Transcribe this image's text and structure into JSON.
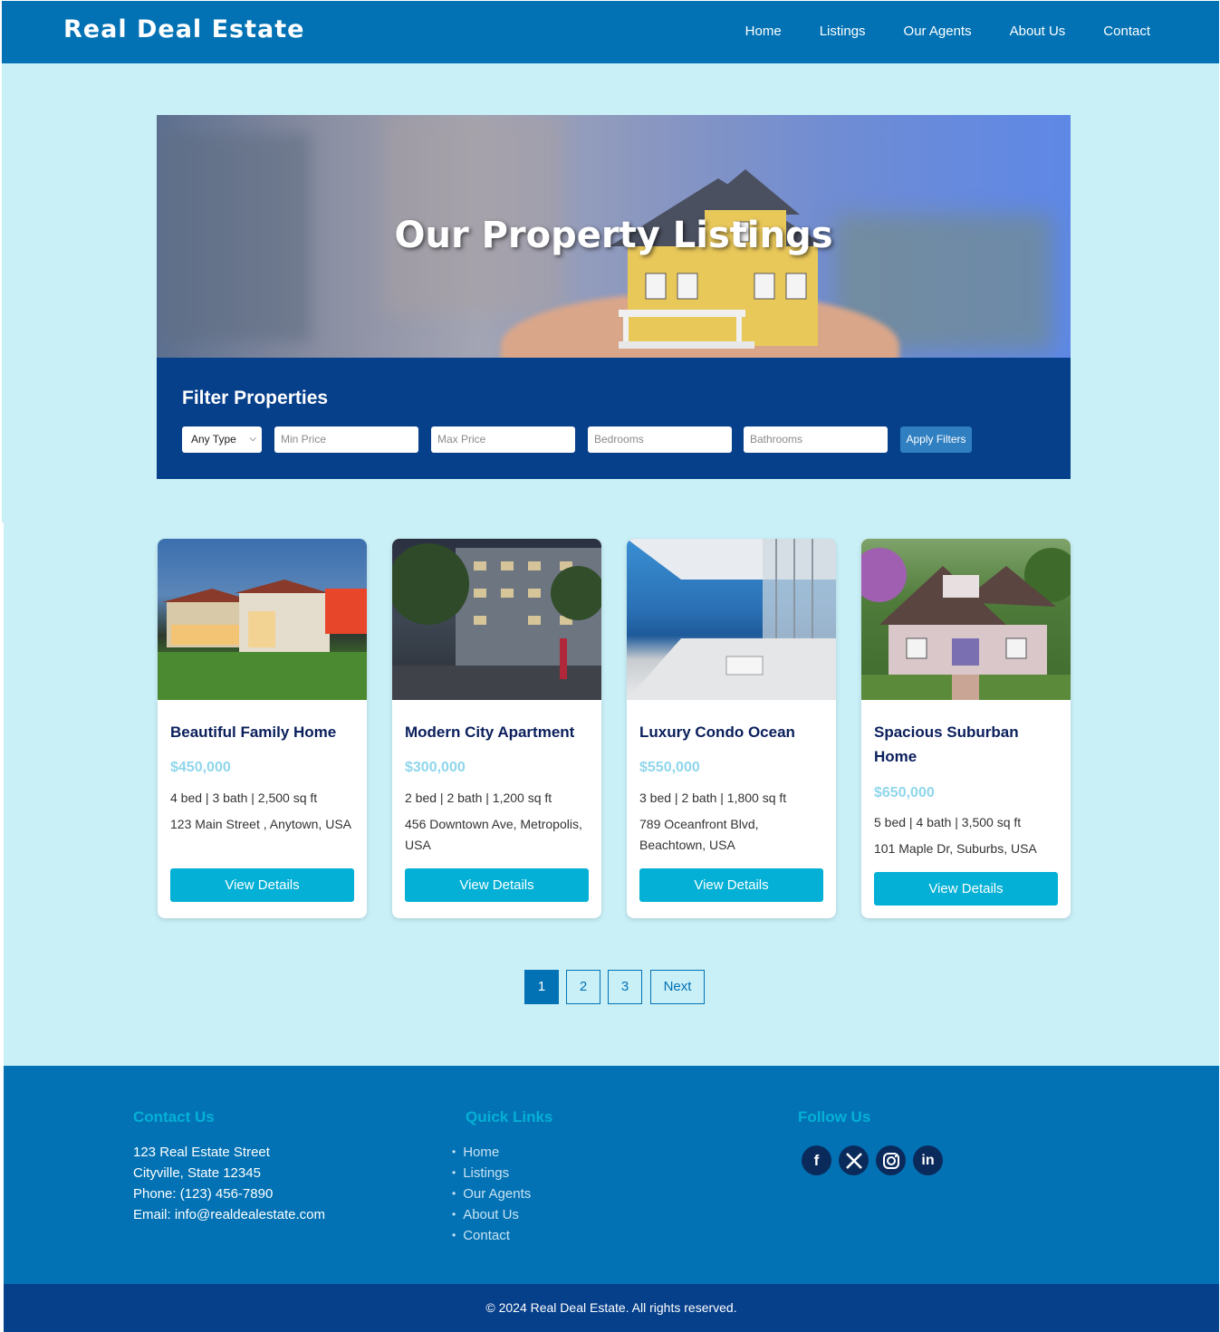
{
  "header": {
    "logo": "Real Deal Estate",
    "nav": [
      "Home",
      "Listings",
      "Our Agents",
      "About Us",
      "Contact"
    ]
  },
  "hero": {
    "title": "Our Property Listings"
  },
  "filter": {
    "title": "Filter Properties",
    "type_selected": "Any Type",
    "min_price_placeholder": "Min Price",
    "max_price_placeholder": "Max Price",
    "bedrooms_placeholder": "Bedrooms",
    "bathrooms_placeholder": "Bathrooms",
    "apply_label": "Apply Filters"
  },
  "listings": [
    {
      "title": "Beautiful Family Home",
      "price": "$450,000",
      "specs": "4 bed | 3 bath | 2,500 sq ft",
      "address": "123 Main Street , Anytown, USA",
      "button": "View Details"
    },
    {
      "title": "Modern City Apartment",
      "price": "$300,000",
      "specs": "2 bed | 2 bath | 1,200 sq ft",
      "address": "456 Downtown Ave, Metropolis, USA",
      "button": "View Details"
    },
    {
      "title": "Luxury Condo Ocean",
      "price": "$550,000",
      "specs": "3 bed | 2 bath | 1,800 sq ft",
      "address": "789 Oceanfront Blvd, Beachtown, USA",
      "button": "View Details"
    },
    {
      "title": "Spacious Suburban Home",
      "price": "$650,000",
      "specs": "5 bed | 4 bath | 3,500 sq ft",
      "address": "101 Maple Dr, Suburbs, USA",
      "button": "View Details"
    }
  ],
  "pagination": {
    "pages": [
      "1",
      "2",
      "3"
    ],
    "next": "Next",
    "current": "1"
  },
  "footer": {
    "contact": {
      "heading": "Contact Us",
      "street": "123 Real Estate Street",
      "city": "Cityville, State 12345",
      "phone": "Phone: (123) 456-7890",
      "email": "Email: info@realdealestate.com"
    },
    "quick_links": {
      "heading": "Quick Links",
      "items": [
        "Home",
        "Listings",
        "Our Agents",
        "About Us",
        "Contact"
      ]
    },
    "follow": {
      "heading": "Follow Us",
      "icons": [
        "facebook-icon",
        "x-icon",
        "instagram-icon",
        "linkedin-icon"
      ]
    },
    "copyright": "© 2024 Real Deal Estate. All rights reserved."
  }
}
